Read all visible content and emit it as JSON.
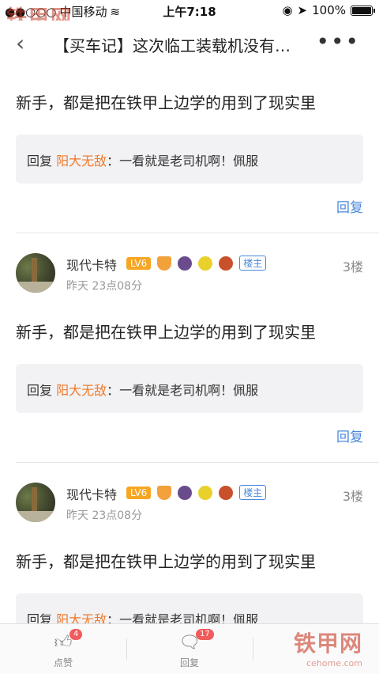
{
  "status_bar": {
    "carrier": "中国移动",
    "time": "上午7:18",
    "battery": "100%"
  },
  "nav": {
    "title": "【买车记】这次临工装载机没有…",
    "more": "•••"
  },
  "watermark": {
    "logo": "铁甲网",
    "site": "cehome.com"
  },
  "posts": [
    {
      "content": "新手，都是把在铁甲上边学的用到了现实里",
      "quote_prefix": "回复",
      "quote_user": "阳大无敌",
      "quote_text": "：一看就是老司机啊！佩服",
      "reply": "回复"
    },
    {
      "username": "现代卡特",
      "level": "LV6",
      "owner_badge": "楼主",
      "floor": "3楼",
      "time": "昨天  23点08分",
      "content": "新手，都是把在铁甲上边学的用到了现实里",
      "quote_prefix": "回复",
      "quote_user": "阳大无敌",
      "quote_text": "：一看就是老司机啊！佩服",
      "reply": "回复"
    },
    {
      "username": "现代卡特",
      "level": "LV6",
      "owner_badge": "楼主",
      "floor": "3楼",
      "time": "昨天  23点08分",
      "content": "新手，都是把在铁甲上边学的用到了现实里",
      "quote_prefix": "回复",
      "quote_user": "阳大无敌",
      "quote_text": "：一看就是老司机啊！佩服"
    }
  ],
  "bottom_bar": {
    "like": {
      "label": "点赞",
      "count": "4"
    },
    "reply": {
      "label": "回复",
      "count": "17"
    }
  }
}
